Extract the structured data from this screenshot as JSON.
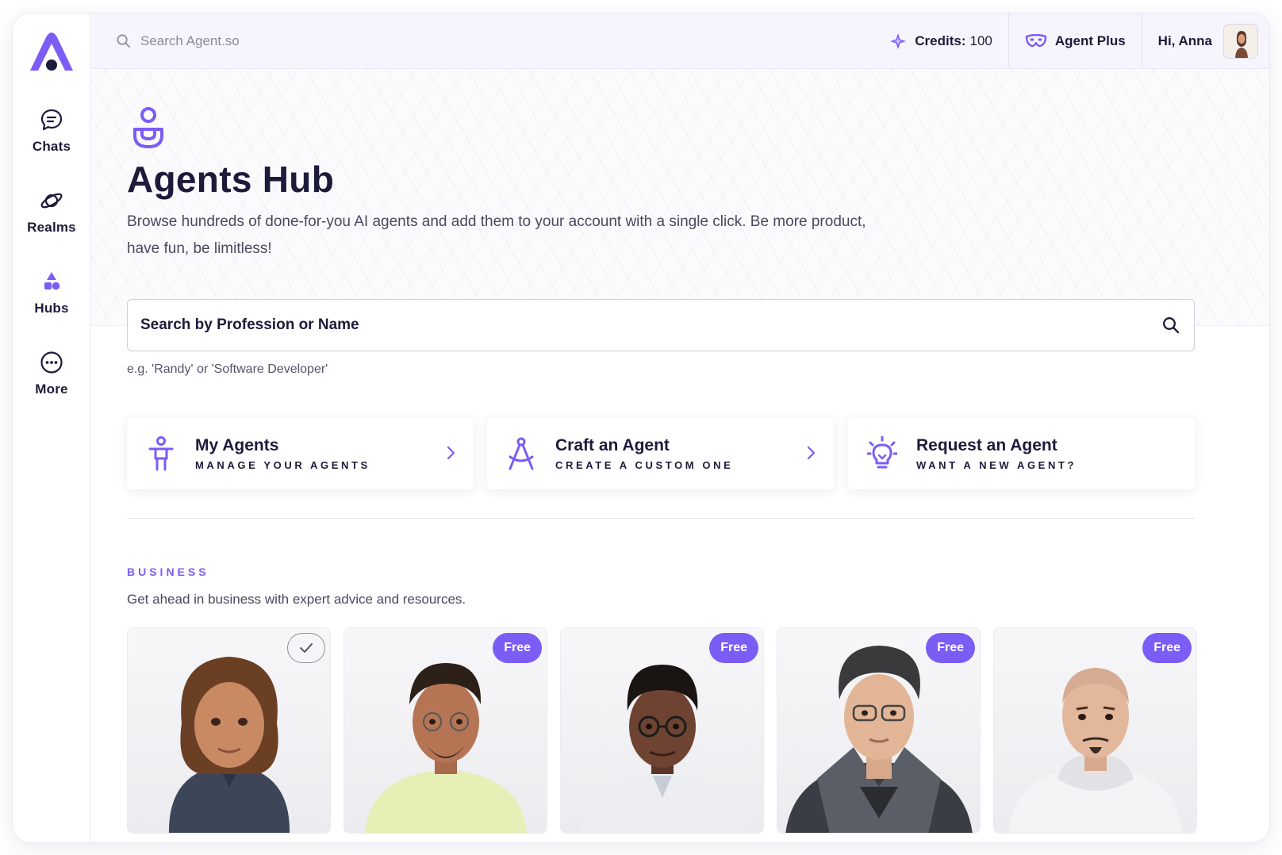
{
  "app": {
    "brand_color": "#7b5cf5",
    "text_color": "#1d1b3a"
  },
  "sidebar": {
    "items": [
      {
        "label": "Chats",
        "icon": "chat-bubble-icon"
      },
      {
        "label": "Realms",
        "icon": "planet-icon"
      },
      {
        "label": "Hubs",
        "icon": "shapes-icon"
      },
      {
        "label": "More",
        "icon": "more-dots-icon"
      }
    ]
  },
  "topbar": {
    "search_placeholder": "Search Agent.so",
    "credits_label": "Credits:",
    "credits_value": "100",
    "plan_label": "Agent Plus",
    "greeting": "Hi, Anna"
  },
  "hero": {
    "title": "Agents Hub",
    "description": "Browse hundreds of done-for-you AI agents and add them to your account with a single click. Be more product, have fun, be limitless!"
  },
  "search": {
    "placeholder": "Search by Profession or Name",
    "hint": "e.g. 'Randy' or 'Software Developer'"
  },
  "actions": [
    {
      "title": "My Agents",
      "subtitle": "MANAGE YOUR AGENTS",
      "icon": "person-icon",
      "has_chevron": true
    },
    {
      "title": "Craft an Agent",
      "subtitle": "CREATE A CUSTOM ONE",
      "icon": "compass-icon",
      "has_chevron": true
    },
    {
      "title": "Request an Agent",
      "subtitle": "WANT A NEW AGENT?",
      "icon": "lightbulb-icon",
      "has_chevron": false
    }
  ],
  "business": {
    "label": "BUSINESS",
    "description": "Get ahead in business with expert advice and resources.",
    "cards": [
      {
        "badge": "",
        "added": true
      },
      {
        "badge": "Free",
        "added": false
      },
      {
        "badge": "Free",
        "added": false
      },
      {
        "badge": "Free",
        "added": false
      },
      {
        "badge": "Free",
        "added": false
      }
    ]
  }
}
